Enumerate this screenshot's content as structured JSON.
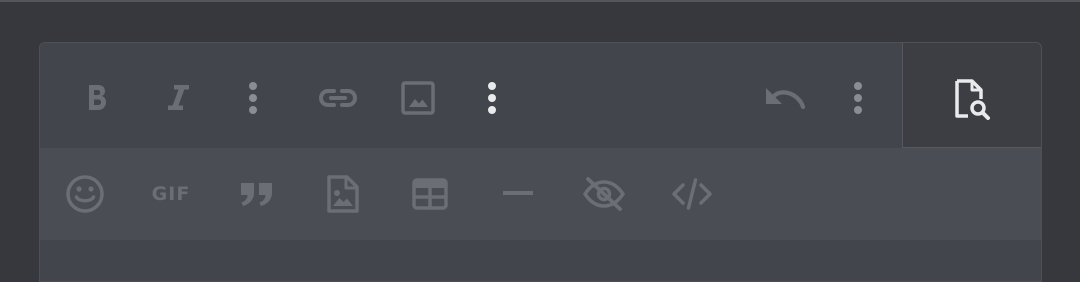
{
  "toolbar_row1": {
    "bold": {
      "icon": "bold-icon"
    },
    "italic": {
      "icon": "italic-icon"
    },
    "more1": {
      "icon": "more-vertical-icon"
    },
    "link": {
      "icon": "link-icon"
    },
    "image": {
      "icon": "image-icon"
    },
    "more2": {
      "icon": "more-vertical-icon"
    },
    "undo": {
      "icon": "undo-icon"
    },
    "more3": {
      "icon": "more-vertical-icon"
    },
    "preview": {
      "icon": "file-search-icon"
    }
  },
  "toolbar_row2": {
    "emoji": {
      "icon": "emoji-icon"
    },
    "gif": {
      "label": "GIF",
      "icon": "gif-icon"
    },
    "quote": {
      "icon": "quote-icon"
    },
    "image_file": {
      "icon": "image-file-icon"
    },
    "table": {
      "icon": "table-icon"
    },
    "horizontal_rule": {
      "icon": "horizontal-rule-icon"
    },
    "spoiler": {
      "icon": "eye-off-icon"
    },
    "code": {
      "icon": "code-icon"
    }
  },
  "colors": {
    "icon_dim": "#6b6e75",
    "icon_mid": "#8a8d94",
    "icon_bright": "#c7c9ce",
    "icon_white": "#e9eaec"
  }
}
